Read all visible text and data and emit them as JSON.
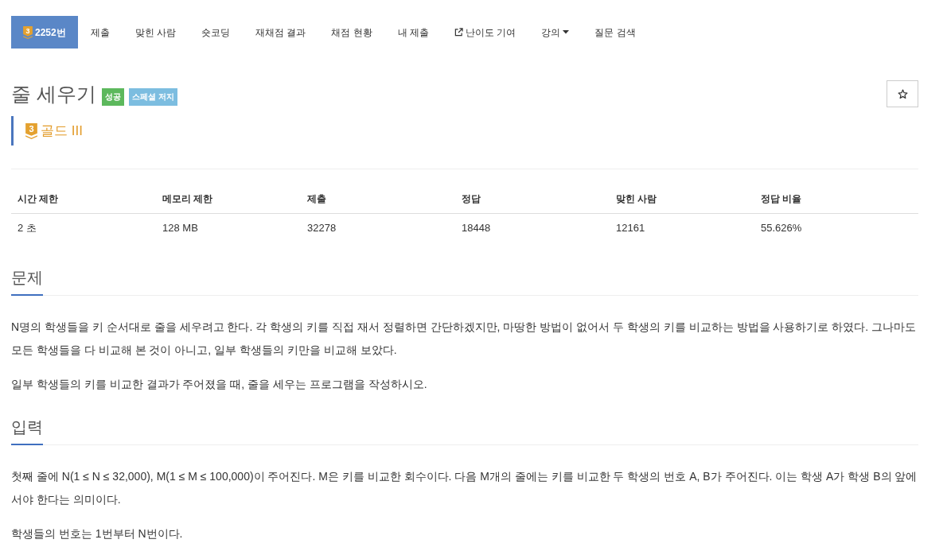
{
  "nav_tabs": [
    {
      "kind": "problem",
      "badge": "3",
      "label": "2252번",
      "selected": true
    },
    {
      "kind": "plain",
      "label": "제출",
      "selected": false
    },
    {
      "kind": "plain",
      "label": "맞힌 사람",
      "selected": false
    },
    {
      "kind": "plain",
      "label": "숏코딩",
      "selected": false
    },
    {
      "kind": "plain",
      "label": "재채점 결과",
      "selected": false
    },
    {
      "kind": "plain",
      "label": "채점 현황",
      "selected": false
    },
    {
      "kind": "plain",
      "label": "내 제출",
      "selected": false
    },
    {
      "kind": "external",
      "label": "난이도 기여",
      "selected": false
    },
    {
      "kind": "dropdown",
      "label": "강의",
      "selected": false
    },
    {
      "kind": "plain",
      "label": "질문 검색",
      "selected": false
    }
  ],
  "title": "줄 세우기",
  "labels": [
    {
      "text": "성공",
      "color": "#5cb85c"
    },
    {
      "text": "스페셜 저지",
      "color": "#7cbde0"
    }
  ],
  "tier": {
    "badge": "3",
    "name": "골드 III"
  },
  "stats_table": {
    "columns": [
      "시간 제한",
      "메모리 제한",
      "제출",
      "정답",
      "맞힌 사람",
      "정답 비율"
    ],
    "rows": [
      [
        "2 초",
        "128 MB",
        "32278",
        "18448",
        "12161",
        "55.626%"
      ]
    ]
  },
  "sections": [
    {
      "heading": "문제",
      "paragraphs": [
        "N명의 학생들을 키 순서대로 줄을 세우려고 한다. 각 학생의 키를 직접 재서 정렬하면 간단하겠지만, 마땅한 방법이 없어서 두 학생의 키를 비교하는 방법을 사용하기로 하였다. 그나마도 모든 학생들을 다 비교해 본 것이 아니고, 일부 학생들의 키만을 비교해 보았다.",
        "일부 학생들의 키를 비교한 결과가 주어졌을 때, 줄을 세우는 프로그램을 작성하시오."
      ]
    },
    {
      "heading": "입력",
      "paragraphs": [
        "첫째 줄에 N(1 ≤ N ≤ 32,000), M(1 ≤ M ≤ 100,000)이 주어진다. M은 키를 비교한 회수이다. 다음 M개의 줄에는 키를 비교한 두 학생의 번호 A, B가 주어진다. 이는 학생 A가 학생 B의 앞에 서야 한다는 의미이다.",
        "학생들의 번호는 1번부터 N번이다."
      ]
    }
  ]
}
